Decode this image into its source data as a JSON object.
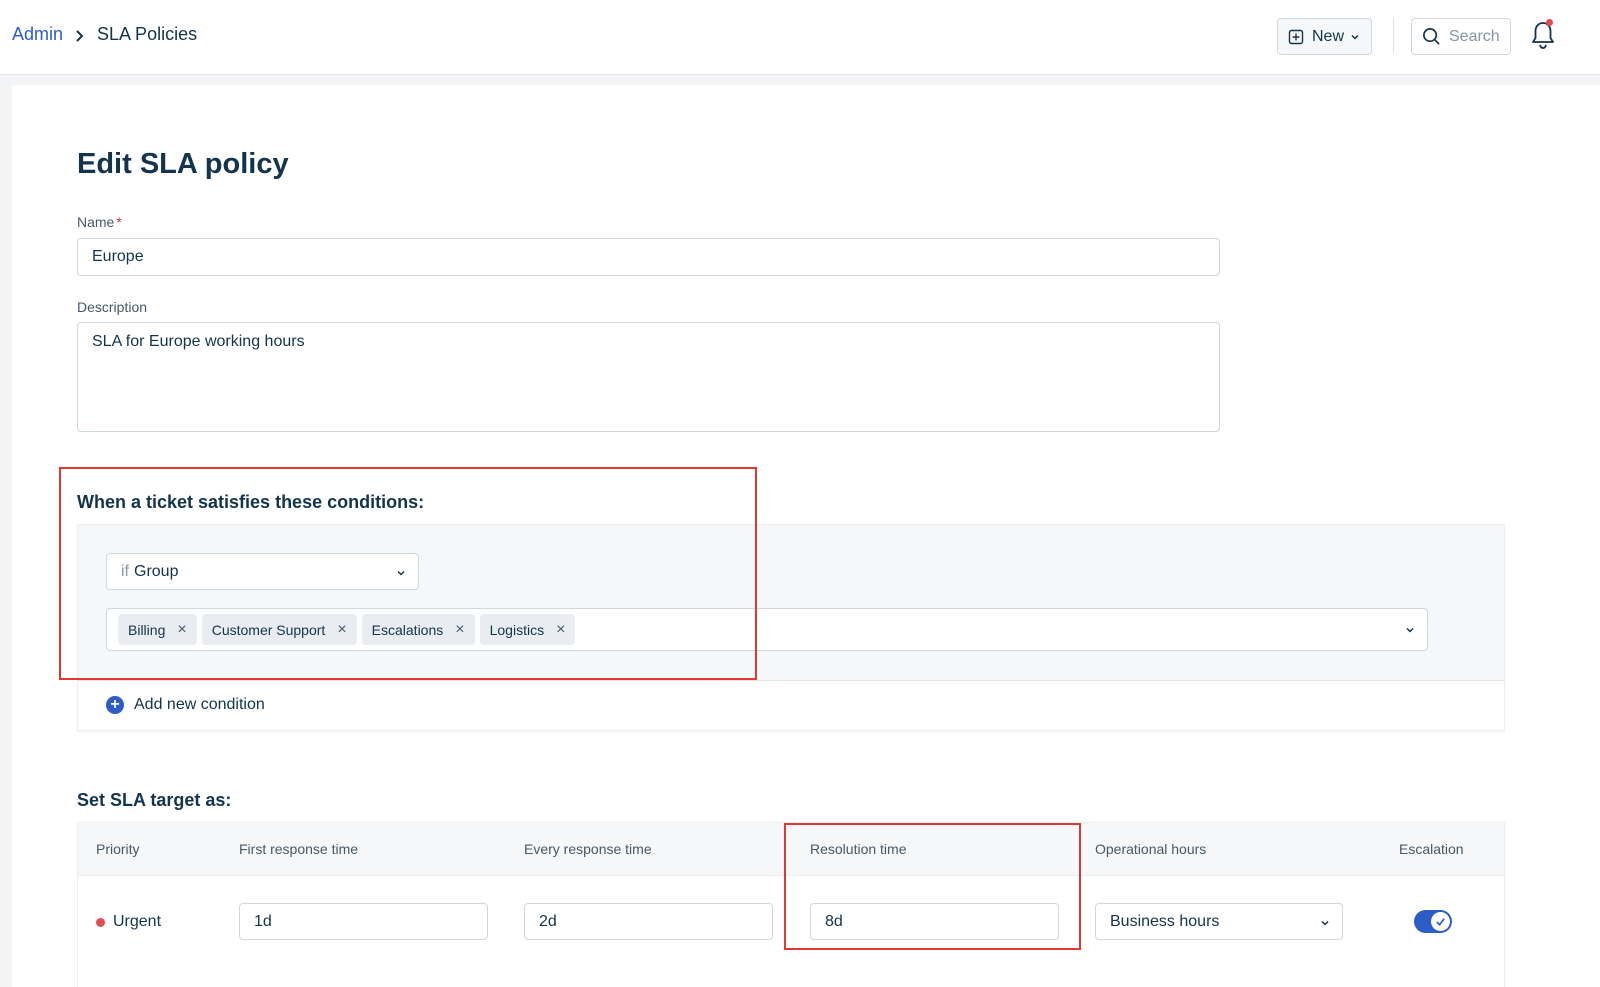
{
  "breadcrumb": {
    "parent": "Admin",
    "current": "SLA Policies"
  },
  "header": {
    "new_label": "New",
    "search_placeholder": "Search",
    "notification_dot": true
  },
  "page": {
    "title": "Edit SLA policy"
  },
  "form": {
    "name_label": "Name",
    "name_required_mark": "*",
    "name_value": "Europe",
    "description_label": "Description",
    "description_value": "SLA for Europe working hours"
  },
  "conditions": {
    "heading": "When a ticket satisfies these conditions:",
    "if_word": "if",
    "field": "Group",
    "values": [
      "Billing",
      "Customer Support",
      "Escalations",
      "Logistics"
    ],
    "remove_glyph": "×",
    "add_label": "Add new condition"
  },
  "sla_target": {
    "heading": "Set SLA target as:",
    "columns": [
      "Priority",
      "First response time",
      "Every response time",
      "Resolution time",
      "Operational hours",
      "Escalation"
    ],
    "rows": [
      {
        "priority": "Urgent",
        "priority_color": "#e5484d",
        "first_response": "1d",
        "every_response": "2d",
        "resolution": "8d",
        "operational_hours": "Business hours",
        "escalation": true
      }
    ]
  },
  "colors": {
    "accent": "#2c5cc5",
    "highlight": "#e0392e",
    "text": "#12344d"
  }
}
